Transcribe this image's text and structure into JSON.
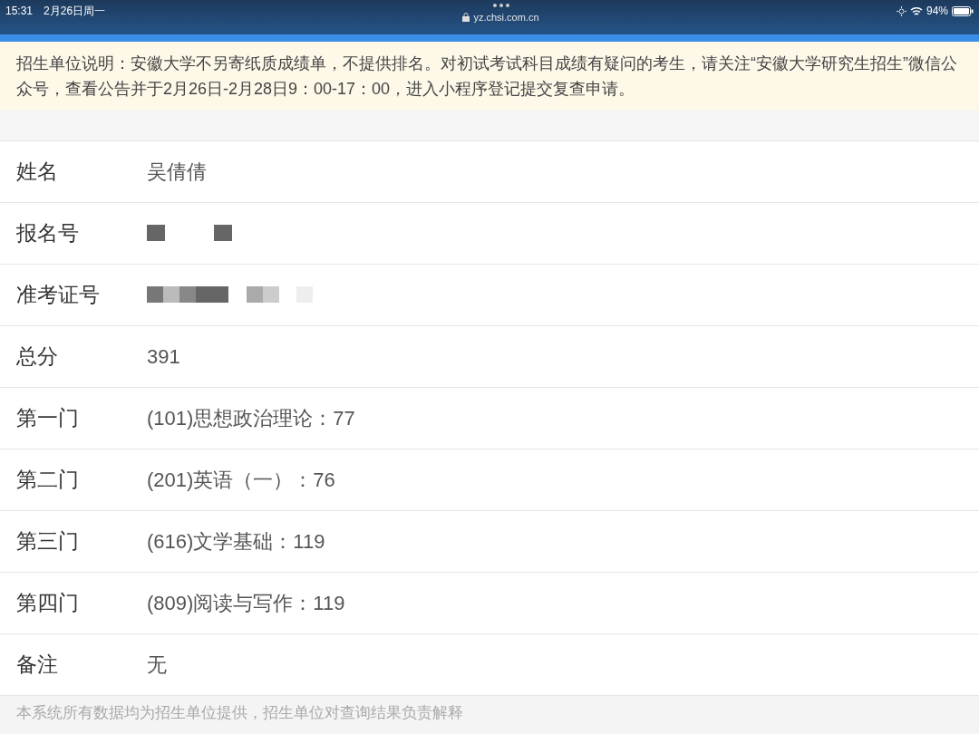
{
  "status_bar": {
    "time": "15:31",
    "date": "2月26日周一",
    "url": "yz.chsi.com.cn",
    "battery": "94%"
  },
  "notice": "招生单位说明：安徽大学不另寄纸质成绩单，不提供排名。对初试考试科目成绩有疑问的考生，请关注“安徽大学研究生招生”微信公众号，查看公告并于2月26日-2月28日9：00-17：00，进入小程序登记提交复查申请。",
  "rows": [
    {
      "label": "姓名",
      "value": "吴倩倩",
      "redacted": false
    },
    {
      "label": "报名号",
      "redacted": true
    },
    {
      "label": "准考证号",
      "redacted": true
    },
    {
      "label": "总分",
      "value": "391",
      "redacted": false
    },
    {
      "label": "第一门",
      "value": "(101)思想政治理论：77",
      "redacted": false
    },
    {
      "label": "第二门",
      "value": "(201)英语（一）：76",
      "redacted": false
    },
    {
      "label": "第三门",
      "value": "(616)文学基础：119",
      "redacted": false
    },
    {
      "label": "第四门",
      "value": "(809)阅读与写作：119",
      "redacted": false
    },
    {
      "label": "备注",
      "value": "无",
      "redacted": false
    }
  ],
  "footer": "本系统所有数据均为招生单位提供，招生单位对查询结果负责解释"
}
